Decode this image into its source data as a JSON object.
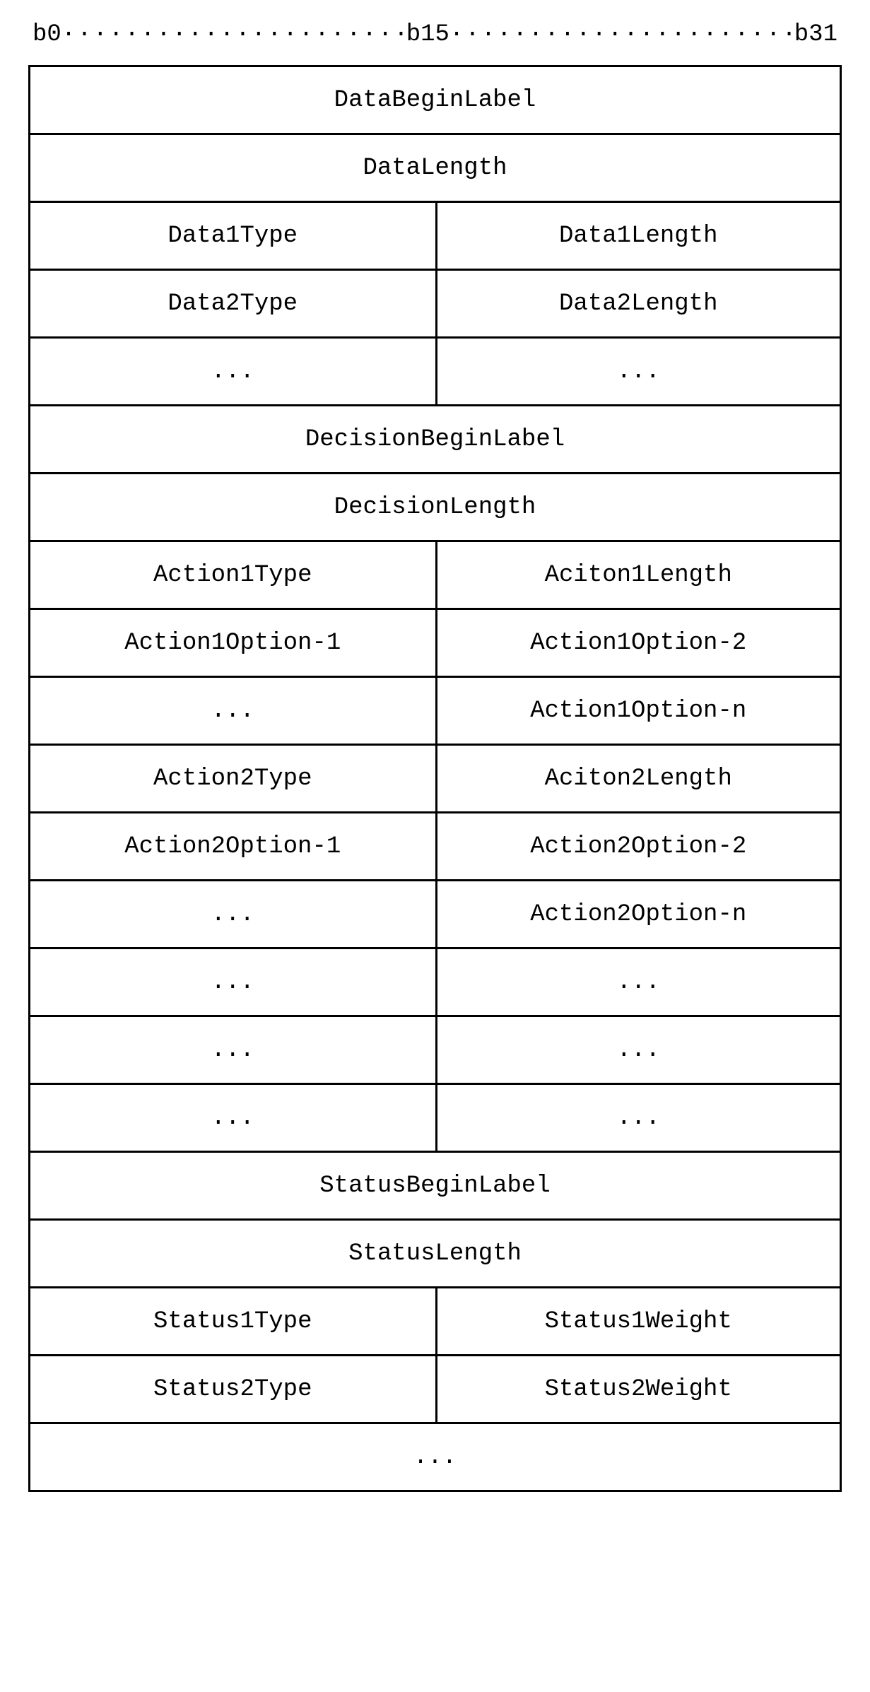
{
  "ruler": {
    "b0": "b0",
    "b15": "b15",
    "b31": "b31"
  },
  "rows": [
    {
      "type": "full",
      "c1": "DataBeginLabel"
    },
    {
      "type": "full",
      "c1": "DataLength"
    },
    {
      "type": "split",
      "c1": "Data1Type",
      "c2": "Data1Length"
    },
    {
      "type": "split",
      "c1": "Data2Type",
      "c2": "Data2Length"
    },
    {
      "type": "split",
      "c1": "...",
      "c2": "..."
    },
    {
      "type": "full",
      "c1": "DecisionBeginLabel"
    },
    {
      "type": "full",
      "c1": "DecisionLength"
    },
    {
      "type": "split",
      "c1": "Action1Type",
      "c2": "Aciton1Length"
    },
    {
      "type": "split",
      "c1": "Action1Option-1",
      "c2": "Action1Option-2"
    },
    {
      "type": "split",
      "c1": "...",
      "c2": "Action1Option-n"
    },
    {
      "type": "split",
      "c1": "Action2Type",
      "c2": "Aciton2Length"
    },
    {
      "type": "split",
      "c1": "Action2Option-1",
      "c2": "Action2Option-2"
    },
    {
      "type": "split",
      "c1": "...",
      "c2": "Action2Option-n"
    },
    {
      "type": "split",
      "c1": "...",
      "c2": "..."
    },
    {
      "type": "split",
      "c1": "...",
      "c2": "..."
    },
    {
      "type": "split",
      "c1": "...",
      "c2": "..."
    },
    {
      "type": "full",
      "c1": "StatusBeginLabel"
    },
    {
      "type": "full",
      "c1": "StatusLength"
    },
    {
      "type": "split",
      "c1": "Status1Type",
      "c2": "Status1Weight"
    },
    {
      "type": "split",
      "c1": "Status2Type",
      "c2": "Status2Weight"
    },
    {
      "type": "full",
      "c1": "..."
    }
  ]
}
